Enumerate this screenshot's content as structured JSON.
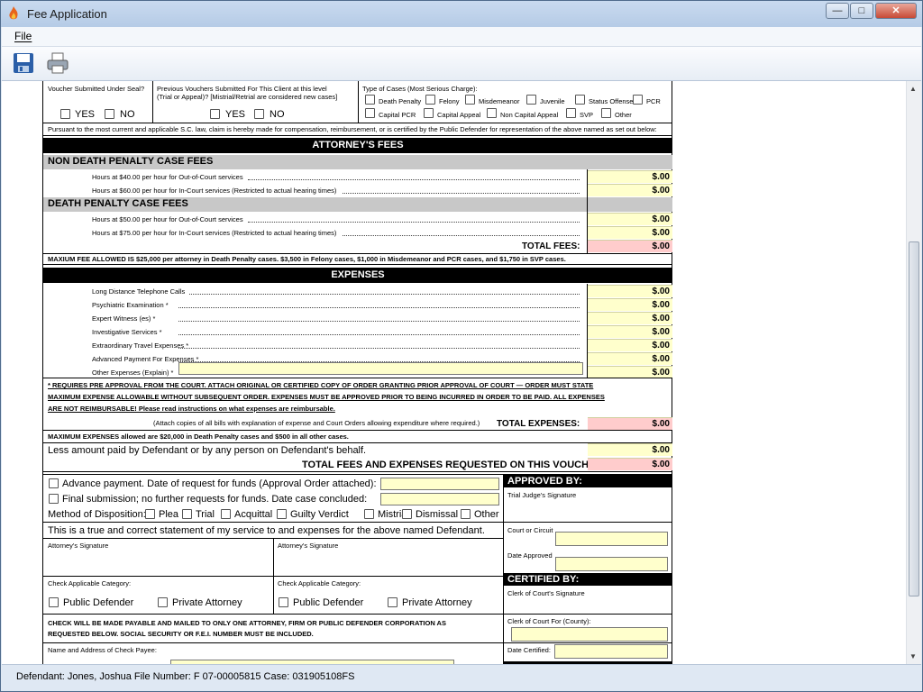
{
  "window": {
    "title": "Fee Application",
    "minimize": "—",
    "maximize": "□",
    "close": "✕"
  },
  "menu": {
    "file": "File"
  },
  "toolbar": {
    "save_icon": "save-icon",
    "print_icon": "print-icon"
  },
  "header": {
    "seal_q": "Voucher Submitted Under Seal?",
    "prev_q1": "Previous Vouchers Submitted For This Client at this level",
    "prev_q2": "(Trial or Appeal)? [Mistrial/Retrial are considered new cases]",
    "yes": "YES",
    "no": "NO",
    "case_types_label": "Type of Cases (Most Serious Charge):",
    "case_types_row1": [
      "Death Penalty",
      "Felony",
      "Misdemeanor",
      "Juvenile",
      "Status Offense",
      "PCR"
    ],
    "case_types_row2": [
      "Capital PCR",
      "Capital Appeal",
      "Non Capital Appeal",
      "SVP",
      "Other"
    ],
    "pursuant": "Pursuant to the most current and applicable S.C. law, claim is hereby made for compensation, reimbursement, or is certified by the Public Defender for representation of the above named as set out below:"
  },
  "attorney_fees": {
    "title": "ATTORNEY'S FEES",
    "non_death_title": "NON DEATH PENALTY CASE FEES",
    "nd_rows": [
      {
        "label": "Hours at $40.00 per hour for Out-of-Court services",
        "amount": "$.00"
      },
      {
        "label": "Hours at $60.00 per hour for In-Court services (Restricted to actual hearing times)",
        "amount": "$.00"
      }
    ],
    "death_title": "DEATH PENALTY CASE FEES",
    "d_rows": [
      {
        "label": "Hours at $50.00 per hour for Out-of-Court services",
        "amount": "$.00"
      },
      {
        "label": "Hours at $75.00 per hour for In-Court services (Restricted to actual hearing times)",
        "amount": "$.00"
      }
    ],
    "total_label": "TOTAL FEES:",
    "total": "$.00",
    "max_note": "MAXIUM FEE ALLOWED IS $25,000 per attorney in Death Penalty cases. $3,500 in Felony cases, $1,000 in Misdemeanor and PCR cases, and $1,750 in SVP cases."
  },
  "expenses": {
    "title": "EXPENSES",
    "rows": [
      {
        "label": "Long Distance Telephone Calls",
        "amount": "$.00"
      },
      {
        "label": "Psychiatric Examination *",
        "amount": "$.00"
      },
      {
        "label": "Expert Witness (es) *",
        "amount": "$.00"
      },
      {
        "label": "Investigative Services *",
        "amount": "$.00"
      },
      {
        "label": "Extraordinary Travel Expenses *",
        "amount": "$.00"
      },
      {
        "label": "Advanced Payment For Expenses *",
        "amount": "$.00"
      },
      {
        "label": "Other Expenses (Explain) *",
        "amount": "$.00"
      }
    ],
    "req1": "* REQUIRES PRE APPROVAL FROM THE COURT. ATTACH ORIGINAL OR CERTIFIED COPY OF ORDER GRANTING PRIOR APPROVAL OF COURT — ORDER MUST STATE",
    "req2": "MAXIMUM EXPENSE ALLOWABLE WITHOUT SUBSEQUENT ORDER. EXPENSES MUST BE APPROVED PRIOR TO BEING INCURRED IN ORDER TO BE PAID. ALL EXPENSES",
    "req3": "ARE NOT REIMBURSABLE! Please read instructions on what expenses are reimbursable.",
    "attach_note": "(Attach copies of all bills with explanation of expense and Court Orders allowing expenditure where required.)",
    "total_label": "TOTAL EXPENSES:",
    "total": "$.00",
    "max_note": "MAXIMUM EXPENSES allowed are $20,000 in Death Penalty cases and $500 in all other cases.",
    "less_label": "Less amount paid by Defendant or by any person on Defendant's behalf.",
    "less": "$.00",
    "grand_label": "TOTAL FEES AND EXPENSES REQUESTED ON THIS VOUCHER:",
    "grand": "$.00"
  },
  "bottom": {
    "advance": "Advance payment. Date of request for funds (Approval Order attached):",
    "final": "Final submission; no further requests for funds. Date case concluded:",
    "disposition_label": "Method of Disposition:",
    "dispositions": [
      "Plea",
      "Trial",
      "Acquittal",
      "Guilty Verdict",
      "Mistrial",
      "Dismissal",
      "Other"
    ],
    "statement": "This is a true and correct statement of my service to and expenses for the above named Defendant.",
    "atty_sig": "Attorney's Signature",
    "check_cat": "Check Applicable Category:",
    "public_defender": "Public Defender",
    "private_attorney": "Private Attorney",
    "check_note1": "CHECK WILL BE MADE PAYABLE AND MAILED TO ONLY ONE ATTORNEY, FIRM OR PUBLIC DEFENDER CORPORATION AS",
    "check_note2": "REQUESTED BELOW. SOCIAL SECURITY OR F.E.I. NUMBER MUST BE INCLUDED.",
    "payee_label": "Name and Address of Check Payee:"
  },
  "approved": {
    "title": "APPROVED BY:",
    "judge_sig": "Trial Judge's Signature",
    "court": "Court or Circuit",
    "date_approved": "Date Approved"
  },
  "certified": {
    "title": "CERTIFIED BY:",
    "clerk_sig": "Clerk of Court's Signature",
    "clerk_for": "Clerk of Court For (County):",
    "date_certified": "Date Certified:"
  },
  "status": {
    "text": "Defendant: Jones, Joshua  File Number: F  07-00005815  Case: 031905108FS"
  }
}
